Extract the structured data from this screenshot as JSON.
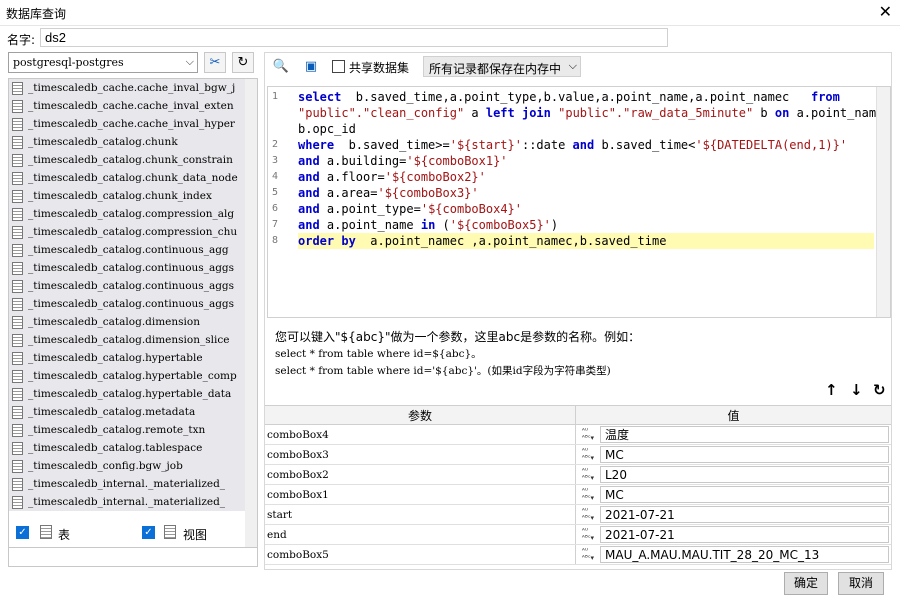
{
  "window": {
    "title": "数据库查询"
  },
  "name": {
    "label": "名字:",
    "value": "ds2"
  },
  "left": {
    "db_select": "postgresql-postgres",
    "tables": [
      "_timescaledb_cache.cache_inval_bgw_j",
      "_timescaledb_cache.cache_inval_exten",
      "_timescaledb_cache.cache_inval_hyper",
      "_timescaledb_catalog.chunk",
      "_timescaledb_catalog.chunk_constrain",
      "_timescaledb_catalog.chunk_data_node",
      "_timescaledb_catalog.chunk_index",
      "_timescaledb_catalog.compression_alg",
      "_timescaledb_catalog.compression_chu",
      "_timescaledb_catalog.continuous_agg",
      "_timescaledb_catalog.continuous_aggs",
      "_timescaledb_catalog.continuous_aggs",
      "_timescaledb_catalog.continuous_aggs",
      "_timescaledb_catalog.dimension",
      "_timescaledb_catalog.dimension_slice",
      "_timescaledb_catalog.hypertable",
      "_timescaledb_catalog.hypertable_comp",
      "_timescaledb_catalog.hypertable_data",
      "_timescaledb_catalog.metadata",
      "_timescaledb_catalog.remote_txn",
      "_timescaledb_catalog.tablespace",
      "_timescaledb_config.bgw_job",
      "_timescaledb_internal._materialized_",
      "_timescaledb_internal._materialized_"
    ],
    "check_tables_label": "表",
    "check_views_label": "视图"
  },
  "toolbar": {
    "share_label": "共享数据集",
    "store_option": "所有记录都保存在内存中"
  },
  "editor": {
    "line_numbers": [
      "1",
      "2",
      "3",
      "4",
      "5",
      "6",
      "7",
      "8"
    ],
    "lines": [
      [
        {
          "t": "select",
          "k": "kw"
        },
        {
          "t": "  b.saved_time,a.point_type,b.value,a.point_name,a.point_namec   "
        },
        {
          "t": "from",
          "k": "kw"
        }
      ],
      [
        {
          "t": "\"public\".\"clean_config\"",
          "k": "str"
        },
        {
          "t": " a "
        },
        {
          "t": "left join",
          "k": "kw"
        },
        {
          "t": " "
        },
        {
          "t": "\"public\".\"raw_data_5minute\"",
          "k": "str"
        },
        {
          "t": " b "
        },
        {
          "t": "on",
          "k": "kw"
        },
        {
          "t": " a.point_name="
        }
      ],
      [
        {
          "t": "b.opc_id"
        }
      ],
      [
        {
          "t": "where",
          "k": "kw"
        },
        {
          "t": "  b.saved_time>="
        },
        {
          "t": "'${start}'",
          "k": "str"
        },
        {
          "t": "::date "
        },
        {
          "t": "and",
          "k": "kw"
        },
        {
          "t": " b.saved_time<"
        },
        {
          "t": "'${DATEDELTA(end,1)}'",
          "k": "str"
        }
      ],
      [
        {
          "t": "and",
          "k": "kw"
        },
        {
          "t": " a.building="
        },
        {
          "t": "'${comboBox1}'",
          "k": "str"
        }
      ],
      [
        {
          "t": "and",
          "k": "kw"
        },
        {
          "t": " a.floor="
        },
        {
          "t": "'${comboBox2}'",
          "k": "str"
        }
      ],
      [
        {
          "t": "and",
          "k": "kw"
        },
        {
          "t": " a.area="
        },
        {
          "t": "'${comboBox3}'",
          "k": "str"
        }
      ],
      [
        {
          "t": "and",
          "k": "kw"
        },
        {
          "t": " a.point_type="
        },
        {
          "t": "'${comboBox4}'",
          "k": "str"
        }
      ],
      [
        {
          "t": "and",
          "k": "kw"
        },
        {
          "t": " a.point_name "
        },
        {
          "t": "in",
          "k": "kw"
        },
        {
          "t": " ("
        },
        {
          "t": "'${comboBox5}'",
          "k": "str"
        },
        {
          "t": ")"
        }
      ],
      [
        {
          "t": "order by",
          "k": "kw"
        },
        {
          "t": "  a.point_namec ,a.point_namec,b.saved_time"
        }
      ]
    ]
  },
  "hint": {
    "line1": "您可以键入\"${abc}\"做为一个参数，这里abc是参数的名称。例如：",
    "line2": "select * from table where id=${abc}。",
    "line3": "select * from table where id='${abc}'。(如果id字段为字符串类型)"
  },
  "params": {
    "col_param": "参数",
    "col_value": "值",
    "rows": [
      {
        "name": "comboBox4",
        "value": "温度"
      },
      {
        "name": "comboBox3",
        "value": "MC"
      },
      {
        "name": "comboBox2",
        "value": "L20"
      },
      {
        "name": "comboBox1",
        "value": "MC"
      },
      {
        "name": "start",
        "value": "2021-07-21"
      },
      {
        "name": "end",
        "value": "2021-07-21"
      },
      {
        "name": "comboBox5",
        "value": "MAU_A.MAU.MAU.TIT_28_20_MC_13"
      }
    ]
  },
  "buttons": {
    "ok": "确定",
    "cancel": "取消"
  }
}
